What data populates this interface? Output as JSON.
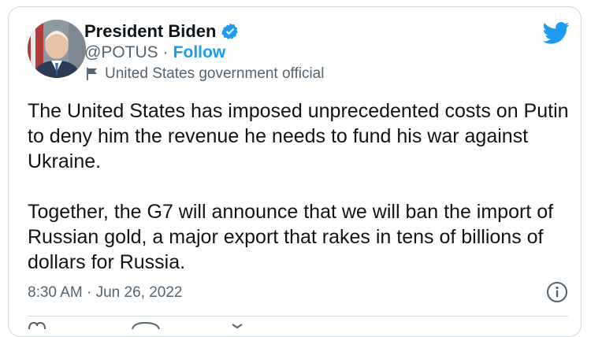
{
  "author": {
    "name": "President Biden",
    "handle": "@POTUS",
    "separator": "·",
    "follow_label": "Follow",
    "label": "United States government official"
  },
  "tweet": {
    "paragraphs": [
      "The United States has imposed unprecedented costs on Putin to deny him the revenue he needs to fund his war against Ukraine.",
      "Together, the G7 will announce that we will ban the import of Russian gold, a major export that rakes in tens of billions of dollars for Russia."
    ],
    "time": "8:30 AM",
    "date": "Jun 26, 2022",
    "meta_separator": "·"
  },
  "colors": {
    "accent": "#1d9bf0",
    "text": "#0f1419",
    "muted": "#536471",
    "border": "#cfd9de"
  },
  "icons": [
    "verified-badge-icon",
    "twitter-bird-icon",
    "government-flag-icon",
    "info-icon"
  ]
}
